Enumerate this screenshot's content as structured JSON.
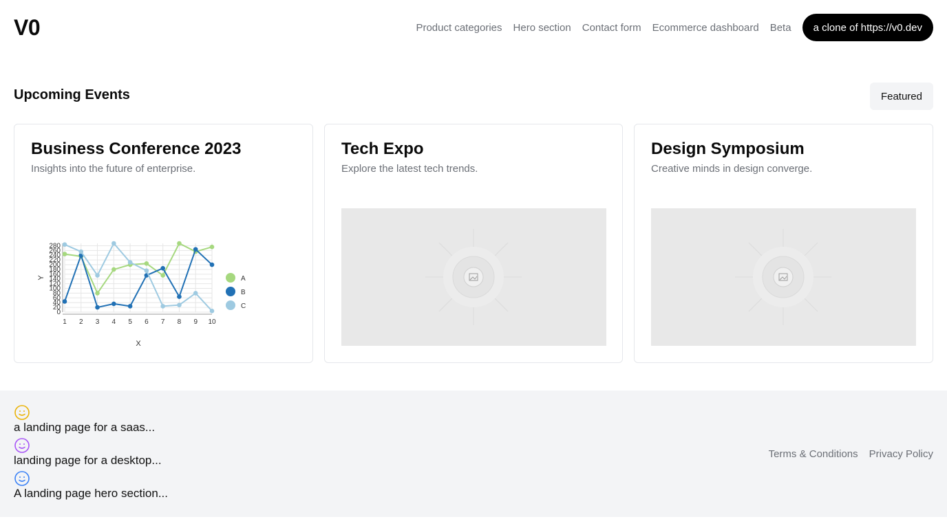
{
  "logo": "V0",
  "nav": {
    "items": [
      "Product categories",
      "Hero section",
      "Contact form",
      "Ecommerce dashboard",
      "Beta"
    ],
    "clone_button": "a clone of https://v0.dev"
  },
  "section": {
    "title": "Upcoming Events",
    "featured_button": "Featured"
  },
  "cards": [
    {
      "title": "Business Conference 2023",
      "description": "Insights into the future of enterprise."
    },
    {
      "title": "Tech Expo",
      "description": "Explore the latest tech trends."
    },
    {
      "title": "Design Symposium",
      "description": "Creative minds in design converge."
    }
  ],
  "chart_data": {
    "type": "line",
    "x": [
      1,
      2,
      3,
      4,
      5,
      6,
      7,
      8,
      9,
      10
    ],
    "xlabel": "X",
    "ylabel": "Y",
    "ylim": [
      0,
      280
    ],
    "yticks": [
      0,
      20,
      40,
      60,
      80,
      100,
      120,
      140,
      160,
      180,
      200,
      220,
      240,
      260,
      280
    ],
    "grid": true,
    "legend_position": "right",
    "series": [
      {
        "name": "A",
        "color": "#a6d87f",
        "values": [
          245,
          235,
          80,
          180,
          200,
          205,
          155,
          290,
          255,
          275
        ]
      },
      {
        "name": "B",
        "color": "#2171b5",
        "values": [
          45,
          240,
          20,
          35,
          25,
          155,
          185,
          65,
          265,
          200
        ]
      },
      {
        "name": "C",
        "color": "#9ecae1",
        "values": [
          285,
          255,
          155,
          295,
          210,
          175,
          25,
          30,
          80,
          5
        ]
      }
    ]
  },
  "footer": {
    "prompts": [
      {
        "text": "a landing page for a saas...",
        "icon": "smile-icon",
        "color": "#eab308"
      },
      {
        "text": "landing page for a desktop...",
        "icon": "smile-icon",
        "color": "#a855f7"
      },
      {
        "text": "A landing page hero section...",
        "icon": "smile-icon",
        "color": "#3b82f6"
      }
    ],
    "links": [
      "Terms & Conditions",
      "Privacy Policy"
    ]
  }
}
